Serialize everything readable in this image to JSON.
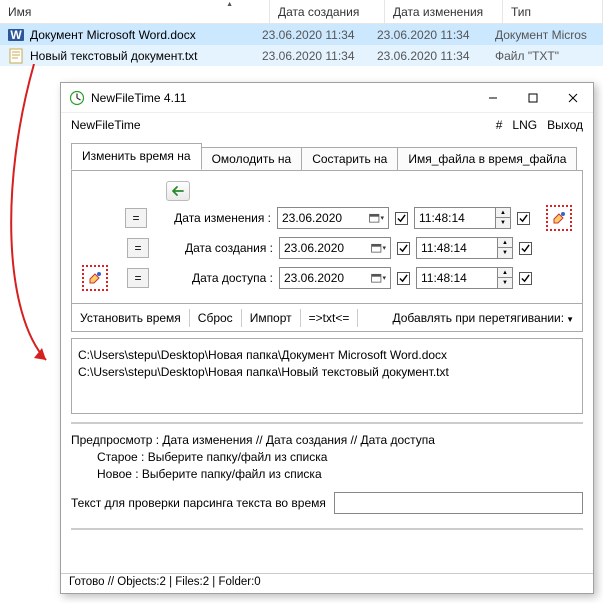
{
  "filelist": {
    "headers": {
      "name": "Имя",
      "created": "Дата создания",
      "modified": "Дата изменения",
      "type": "Тип"
    },
    "rows": [
      {
        "name": "Документ Microsoft Word.docx",
        "created": "23.06.2020 11:34",
        "modified": "23.06.2020 11:34",
        "type": "Документ Micros"
      },
      {
        "name": "Новый текстовый документ.txt",
        "created": "23.06.2020 11:34",
        "modified": "23.06.2020 11:34",
        "type": "Файл \"TXT\""
      }
    ]
  },
  "window": {
    "title": "NewFileTime 4.11",
    "menu_left": "NewFileTime",
    "menu_right": {
      "hash": "#",
      "lng": "LNG",
      "exit": "Выход"
    },
    "tabs": {
      "change": "Изменить время на",
      "rejuvenate": "Омолодить на",
      "age": "Состарить на",
      "filename": "Имя_файла в время_файла"
    },
    "fields": {
      "modified": {
        "label": "Дата изменения :",
        "date": "23.06.2020",
        "time": "11:48:14"
      },
      "created": {
        "label": "Дата создания :",
        "date": "23.06.2020",
        "time": "11:48:14"
      },
      "accessed": {
        "label": "Дата доступа :",
        "date": "23.06.2020",
        "time": "11:48:14"
      },
      "eq": "="
    },
    "actions": {
      "set": "Установить время",
      "reset": "Сброс",
      "import": "Импорт",
      "txt": "=>txt<=",
      "drag": "Добавлять при перетягивании:"
    },
    "paths": [
      "C:\\Users\\stepu\\Desktop\\Новая папка\\Документ Microsoft Word.docx",
      "C:\\Users\\stepu\\Desktop\\Новая папка\\Новый текстовый документ.txt"
    ],
    "preview": {
      "header": "Предпросмотр  :   Дата изменения    //    Дата создания    //    Дата доступа",
      "old": "Старое  :  Выберите папку/файл из списка",
      "new": "Новое  :  Выберите папку/файл из списка"
    },
    "parsing_label": "Текст для проверки парсинга текста во время",
    "status": "Готово // Objects:2 | Files:2  | Folder:0"
  }
}
